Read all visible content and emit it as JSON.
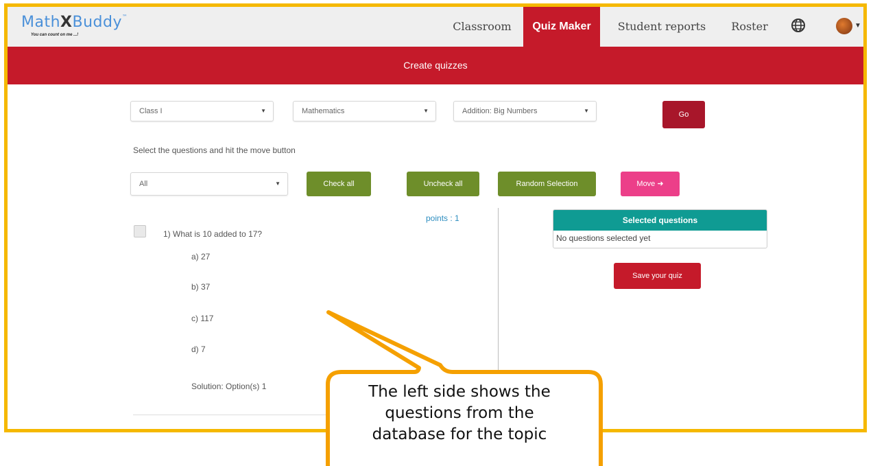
{
  "logo": {
    "text_math": "Math",
    "text_x": "X",
    "text_buddy": "Buddy",
    "tm": "™",
    "tagline": "You can count on me ...!"
  },
  "nav": {
    "items": [
      {
        "label": "Classroom",
        "active": false
      },
      {
        "label": "Quiz Maker",
        "active": true
      },
      {
        "label": "Student reports",
        "active": false
      },
      {
        "label": "Roster",
        "active": false
      }
    ],
    "icons": [
      "globe-icon",
      "avatar"
    ]
  },
  "banner": {
    "title": "Create quizzes"
  },
  "filters": {
    "class": "Class I",
    "subject": "Mathematics",
    "topic": "Addition: Big Numbers",
    "go_label": "Go"
  },
  "instruction": "Select the questions and hit the move button",
  "toolbar": {
    "filter_value": "All",
    "check_all": "Check all",
    "uncheck_all": "Uncheck all",
    "random_selection": "Random Selection",
    "move": "Move ➜"
  },
  "question": {
    "text": "1) What is 10 added to 17?",
    "points": "points : 1",
    "options": [
      "a) 27",
      "b) 37",
      "c) 117",
      "d) 7"
    ],
    "solution": "Solution: Option(s) 1"
  },
  "selected_panel": {
    "title": "Selected questions",
    "empty_text": "No questions selected yet",
    "save_label": "Save your quiz"
  },
  "callout": {
    "lines": [
      "The left side shows the",
      "questions from the",
      "database for the topic"
    ]
  },
  "colors": {
    "frame": "#f5b800",
    "brand_red": "#c51a2a",
    "green": "#6e8e2a",
    "pink": "#ec3f89",
    "teal": "#0f9b93"
  }
}
